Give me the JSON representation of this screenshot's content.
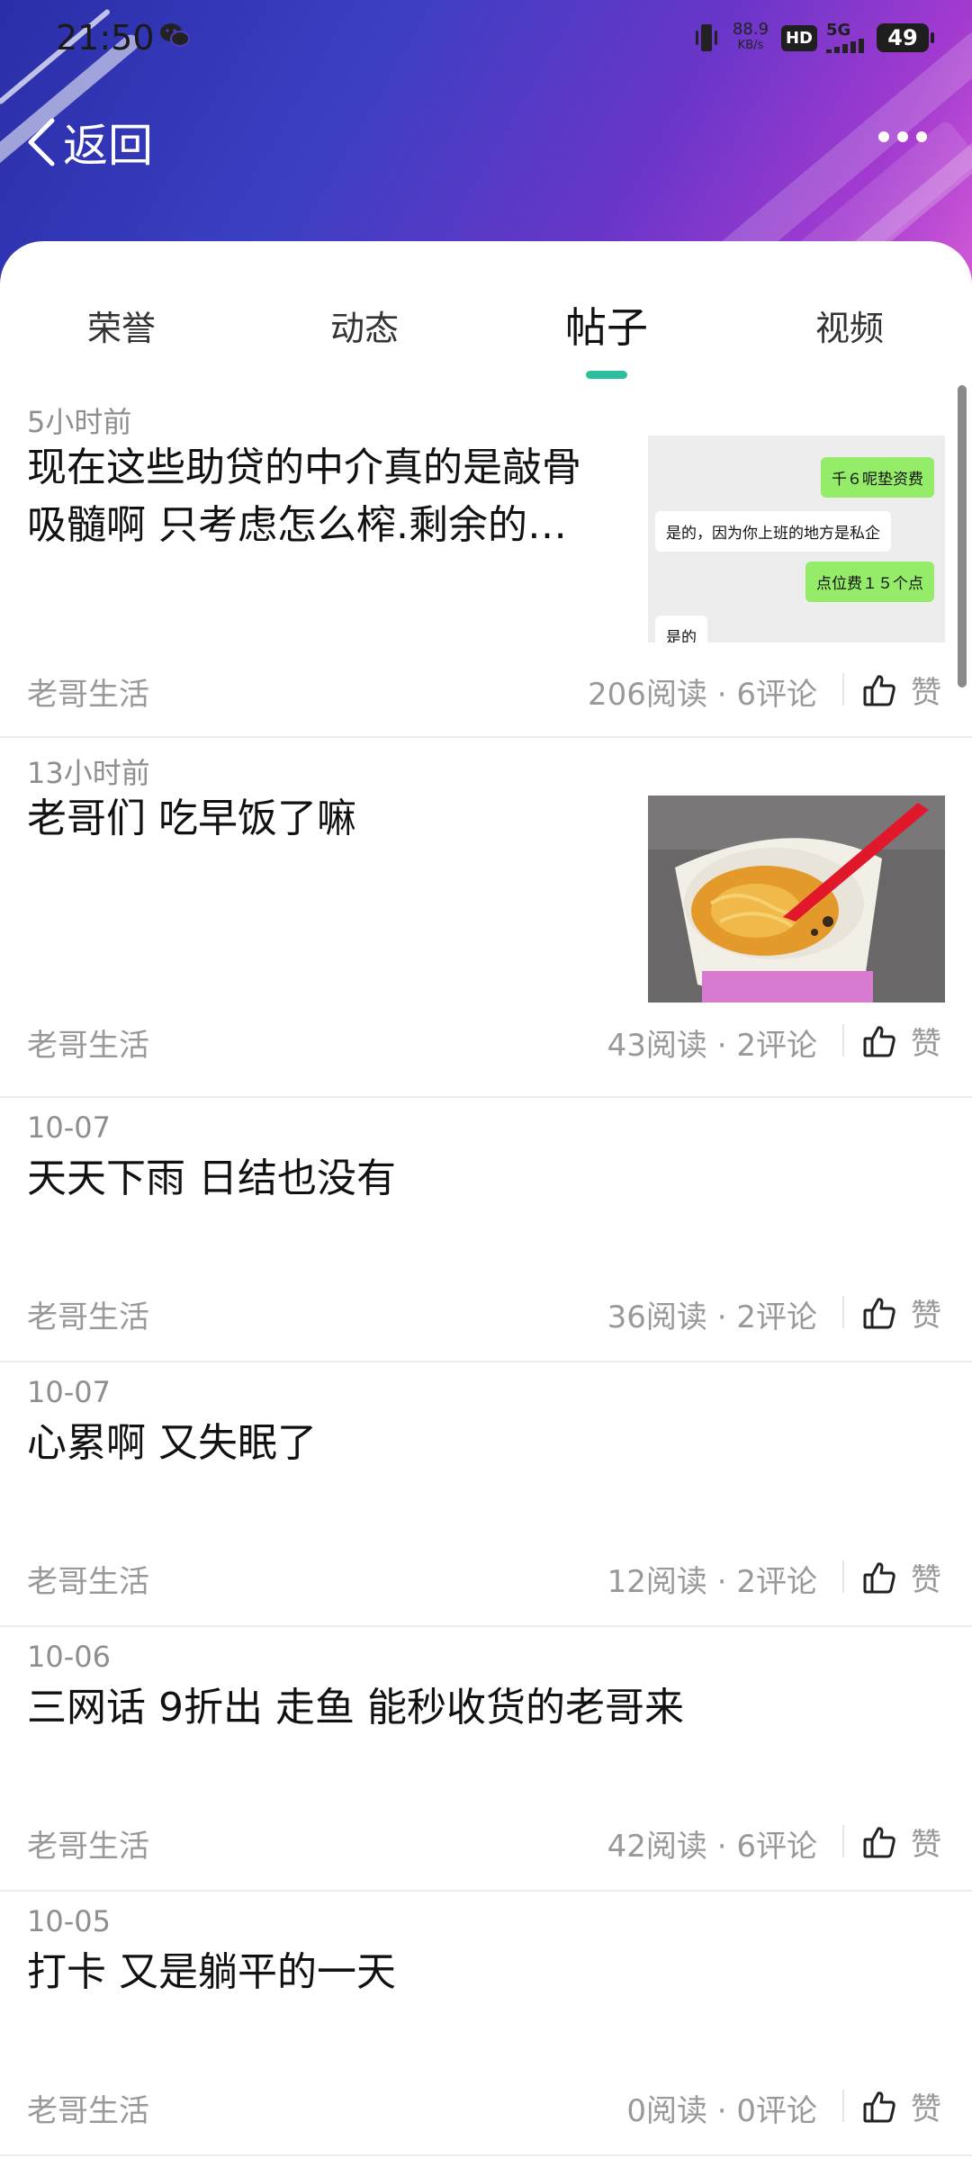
{
  "status_bar": {
    "time": "21:50",
    "network_speed_value": "88.9",
    "network_speed_unit": "KB/s",
    "hd_label": "HD",
    "signal_label": "5G",
    "battery": "49"
  },
  "header": {
    "back_label": "返回"
  },
  "tabs": [
    {
      "label": "荣誉"
    },
    {
      "label": "动态"
    },
    {
      "label": "帖子",
      "active": true
    },
    {
      "label": "视频"
    }
  ],
  "posts": [
    {
      "time": "5小时前",
      "title_line1": "现在这些助贷的中介真的是敲骨",
      "title_line2": "吸髓啊  只考虑怎么榨.剩余的…",
      "author": "老哥生活",
      "stats": "206阅读 · 6评论",
      "like_label": "赞",
      "thumbnail": {
        "type": "chat",
        "bubbles": [
          {
            "side": "right",
            "text": "千６呢垫资费"
          },
          {
            "side": "left",
            "text": "是的，因为你上班的地方是私企"
          },
          {
            "side": "right",
            "text": "点位费１５个点"
          },
          {
            "side": "left",
            "text": "是的"
          }
        ]
      }
    },
    {
      "time": "13小时前",
      "title_line1": "老哥们 吃早饭了嘛",
      "author": "老哥生活",
      "stats": "43阅读 · 2评论",
      "like_label": "赞",
      "thumbnail": {
        "type": "photo",
        "subject": "instant-noodle-cup"
      }
    },
    {
      "time": "10-07",
      "title_line1": "天天下雨 日结也没有",
      "author": "老哥生活",
      "stats": "36阅读 · 2评论",
      "like_label": "赞"
    },
    {
      "time": "10-07",
      "title_line1": "心累啊 又失眠了",
      "author": "老哥生活",
      "stats": "12阅读 · 2评论",
      "like_label": "赞"
    },
    {
      "time": "10-06",
      "title_line1": "三网话  9折出 走鱼  能秒收货的老哥来",
      "author": "老哥生活",
      "stats": "42阅读 · 6评论",
      "like_label": "赞"
    },
    {
      "time": "10-05",
      "title_line1": "打卡 又是躺平的一天",
      "author": "老哥生活",
      "stats": "0阅读 · 0评论",
      "like_label": "赞"
    }
  ],
  "icons": {
    "back": "chevron-left-icon",
    "more": "more-dots-icon",
    "like": "thumbs-up-icon",
    "wechat": "wechat-icon",
    "vibrate": "vibrate-icon"
  },
  "colors": {
    "tab_indicator": "#2dbf9b",
    "chat_green": "#95ec69",
    "header_gradient_start": "#2a2ea8",
    "header_gradient_end": "#d35bd6"
  }
}
